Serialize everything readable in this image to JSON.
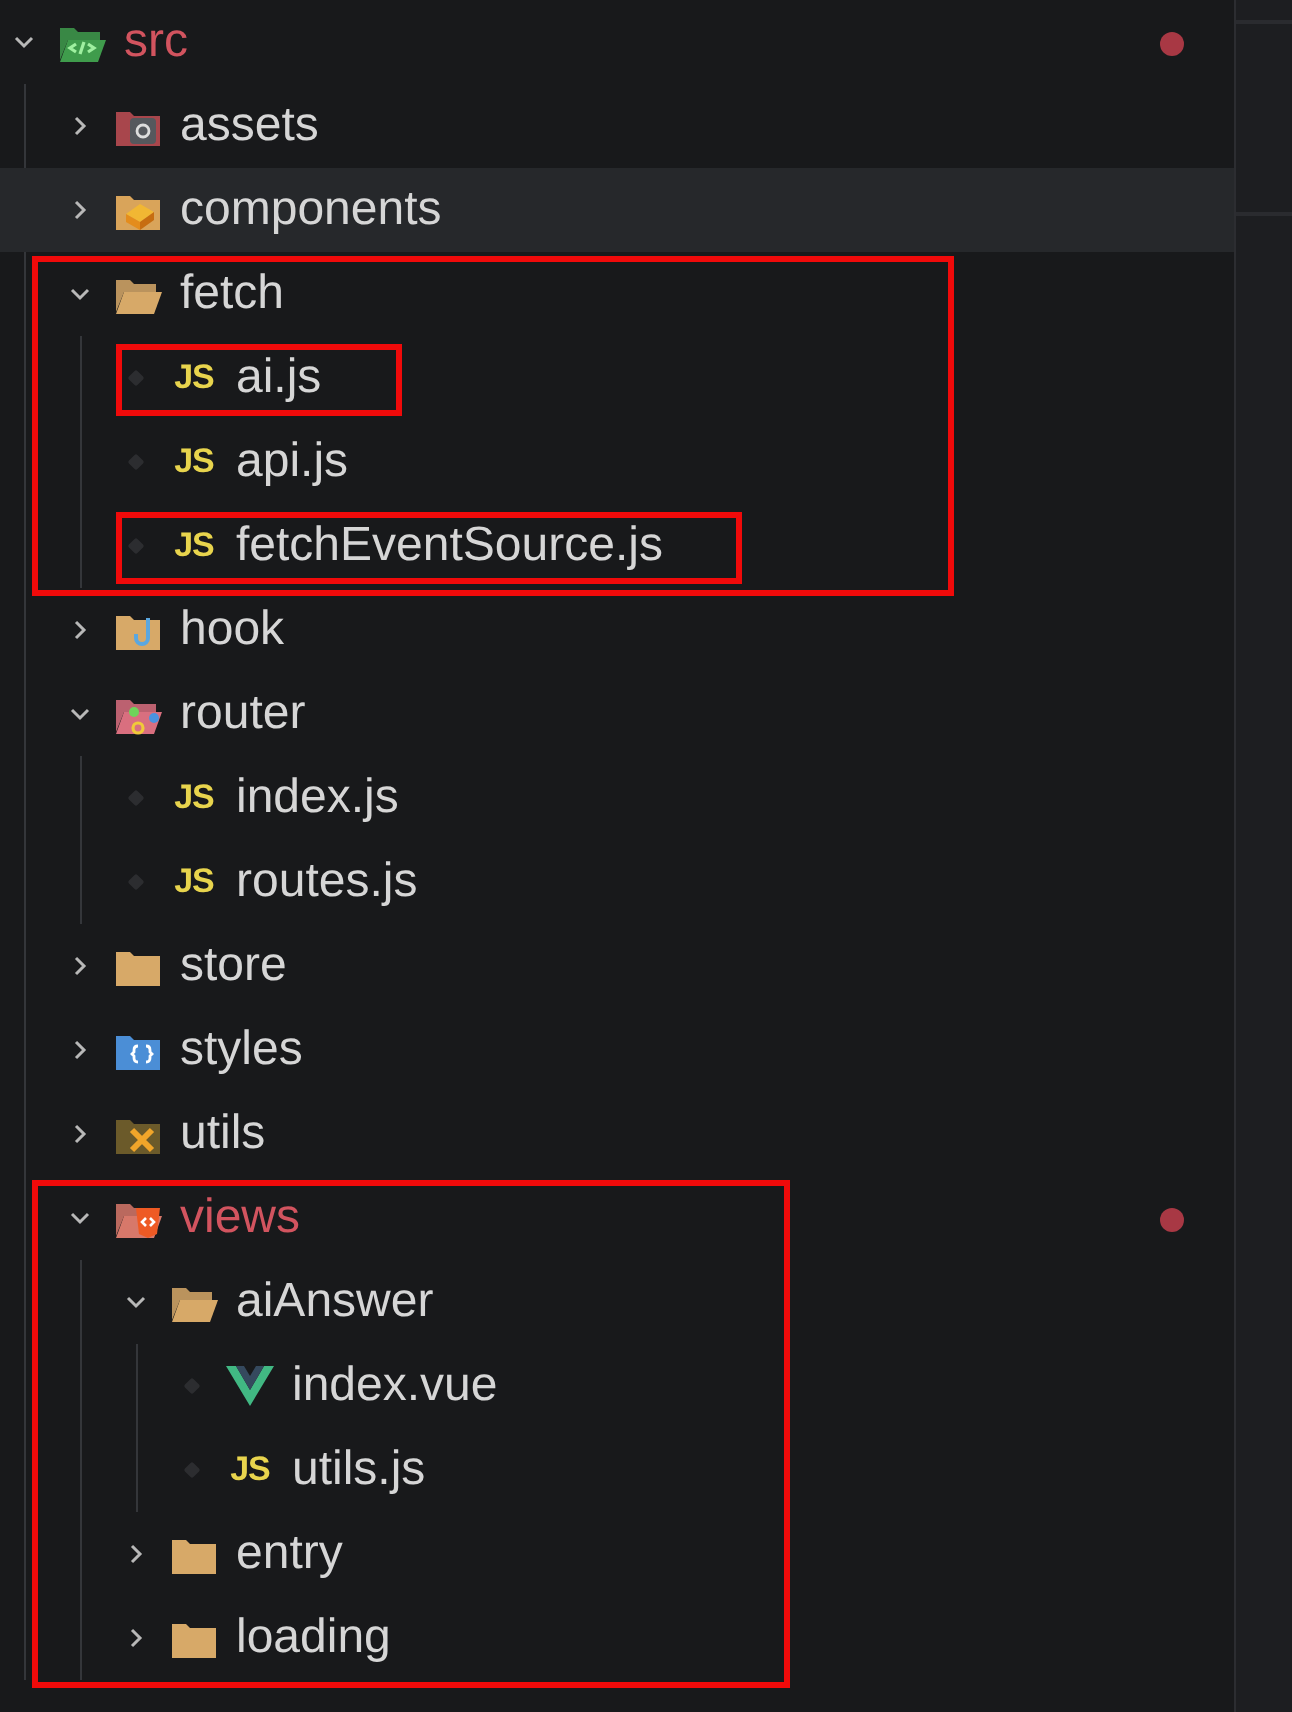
{
  "explorer": {
    "tree": [
      {
        "label": "src",
        "kind": "code-folder",
        "expanded": true,
        "selected": false,
        "boxed": false,
        "modified": true,
        "children": [
          {
            "label": "assets",
            "kind": "gear-folder",
            "expanded": false,
            "selected": false,
            "boxed": false,
            "modified": false
          },
          {
            "label": "components",
            "kind": "block-folder",
            "expanded": false,
            "selected": true,
            "boxed": false,
            "modified": false
          },
          {
            "label": "fetch",
            "kind": "folder",
            "expanded": true,
            "selected": false,
            "boxed": true,
            "modified": false,
            "children": [
              {
                "label": "ai.js",
                "kind": "js-file",
                "badge": "JS",
                "selected": false,
                "boxed": true,
                "modified": false
              },
              {
                "label": "api.js",
                "kind": "js-file",
                "badge": "JS",
                "selected": false,
                "boxed": false,
                "modified": false
              },
              {
                "label": "fetchEventSource.js",
                "kind": "js-file",
                "badge": "JS",
                "selected": false,
                "boxed": true,
                "modified": false
              }
            ]
          },
          {
            "label": "hook",
            "kind": "hook-folder",
            "expanded": false,
            "selected": false,
            "boxed": false,
            "modified": false
          },
          {
            "label": "router",
            "kind": "nodes-folder",
            "expanded": true,
            "selected": false,
            "boxed": false,
            "modified": false,
            "children": [
              {
                "label": "index.js",
                "kind": "js-file",
                "badge": "JS",
                "selected": false,
                "boxed": false,
                "modified": false
              },
              {
                "label": "routes.js",
                "kind": "js-file",
                "badge": "JS",
                "selected": false,
                "boxed": false,
                "modified": false
              }
            ]
          },
          {
            "label": "store",
            "kind": "folder",
            "expanded": false,
            "selected": false,
            "boxed": false,
            "modified": false
          },
          {
            "label": "styles",
            "kind": "brace-folder",
            "expanded": false,
            "selected": false,
            "boxed": false,
            "modified": false
          },
          {
            "label": "utils",
            "kind": "tools-folder",
            "expanded": false,
            "selected": false,
            "boxed": false,
            "modified": false
          },
          {
            "label": "views",
            "kind": "html-folder",
            "expanded": true,
            "selected": false,
            "boxed": true,
            "modified": true,
            "children": [
              {
                "label": "aiAnswer",
                "kind": "folder",
                "expanded": true,
                "selected": false,
                "boxed": false,
                "modified": false,
                "children": [
                  {
                    "label": "index.vue",
                    "kind": "vue-file",
                    "selected": false,
                    "boxed": false,
                    "modified": false
                  },
                  {
                    "label": "utils.js",
                    "kind": "js-file",
                    "badge": "JS",
                    "selected": false,
                    "boxed": false,
                    "modified": false
                  }
                ]
              },
              {
                "label": "entry",
                "kind": "folder",
                "expanded": false,
                "selected": false,
                "boxed": false,
                "modified": false
              },
              {
                "label": "loading",
                "kind": "folder",
                "expanded": false,
                "selected": false,
                "boxed": false,
                "modified": false
              }
            ]
          }
        ]
      }
    ]
  }
}
